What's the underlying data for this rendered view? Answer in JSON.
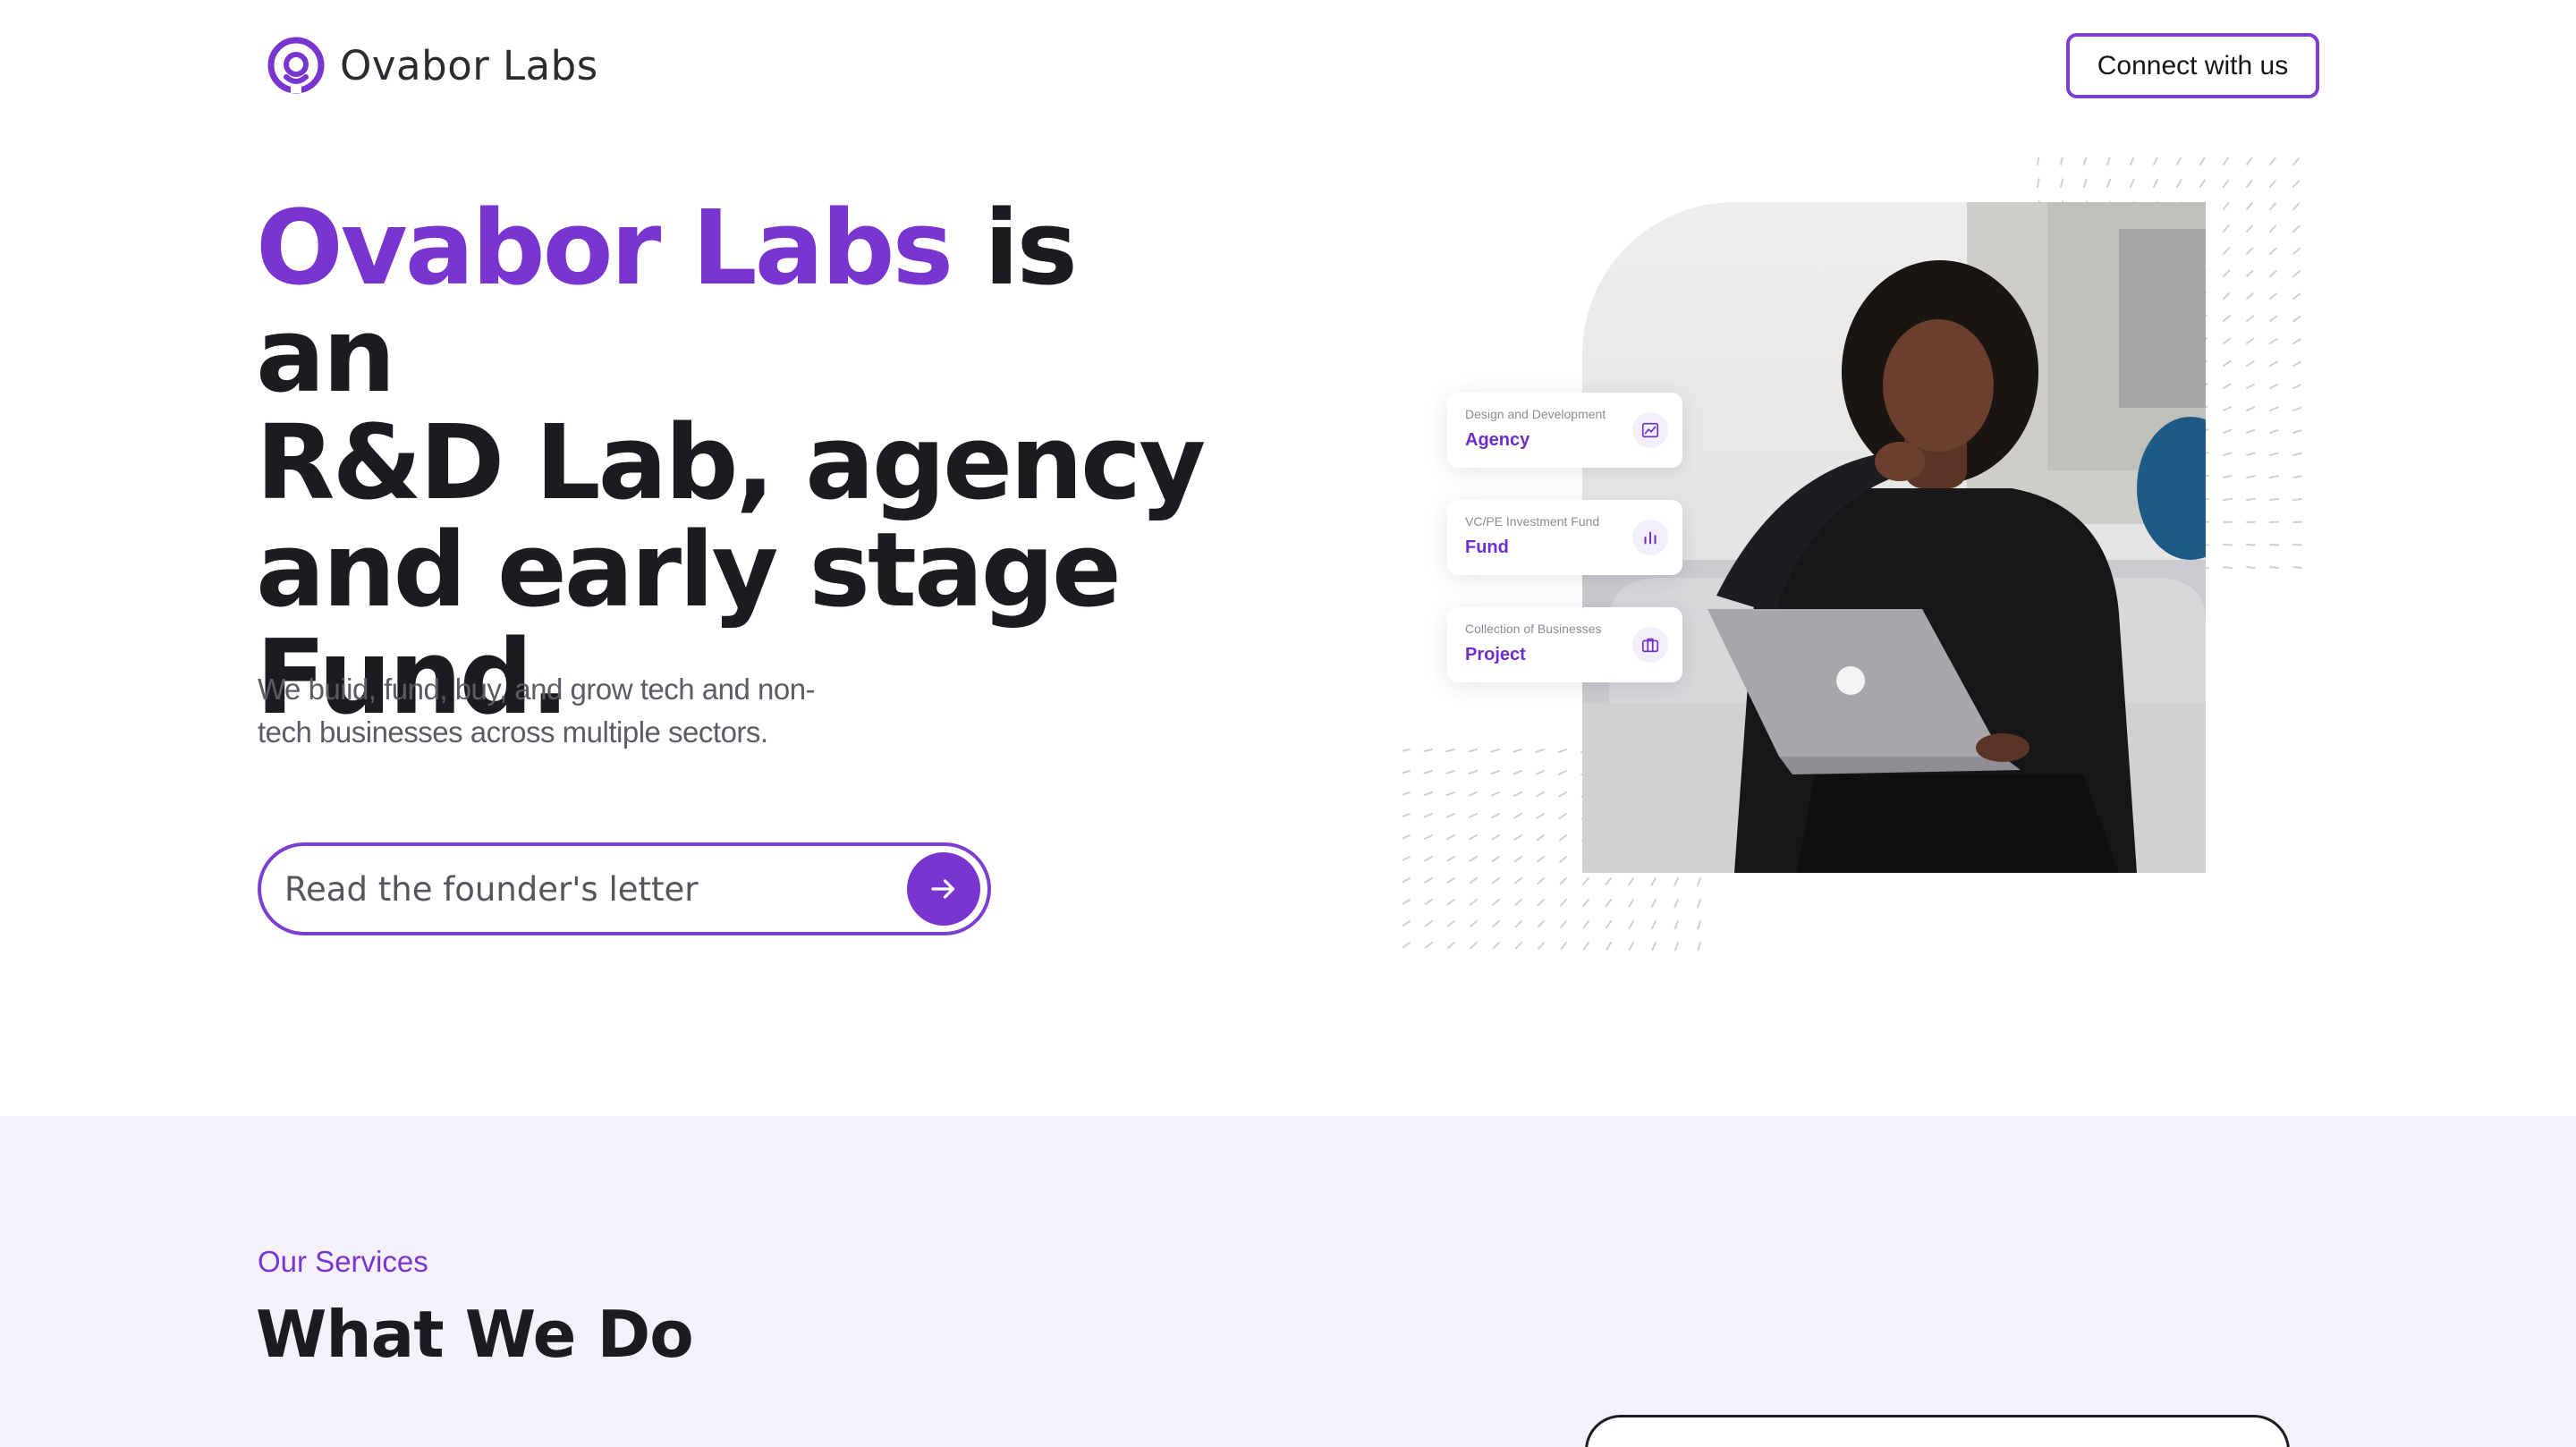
{
  "header": {
    "brand": "Ovabor Labs",
    "connect_label": "Connect with us"
  },
  "hero": {
    "title_accent": "Ovabor Labs",
    "title_rest_1": " is an",
    "title_rest_2": "R&D Lab, agency",
    "title_rest_3": "and early stage",
    "title_rest_4": "Fund.",
    "subtitle": "We buiid, fund, buy, and grow tech and non-tech businesses across multiple sectors.",
    "letter_placeholder": "Read the founder's letter"
  },
  "service_cards": [
    {
      "caption": "Design and Development",
      "name": "Agency",
      "icon": "chart-line-icon"
    },
    {
      "caption": "VC/PE Investment Fund",
      "name": "Fund",
      "icon": "bar-chart-icon"
    },
    {
      "caption": "Collection of Businesses",
      "name": "Project",
      "icon": "briefcase-icon"
    }
  ],
  "services": {
    "eyebrow": "Our Services",
    "title": "What We Do"
  },
  "colors": {
    "accent": "#7a35d0",
    "band": "#f4f0fc",
    "text": "#1c1c20"
  }
}
